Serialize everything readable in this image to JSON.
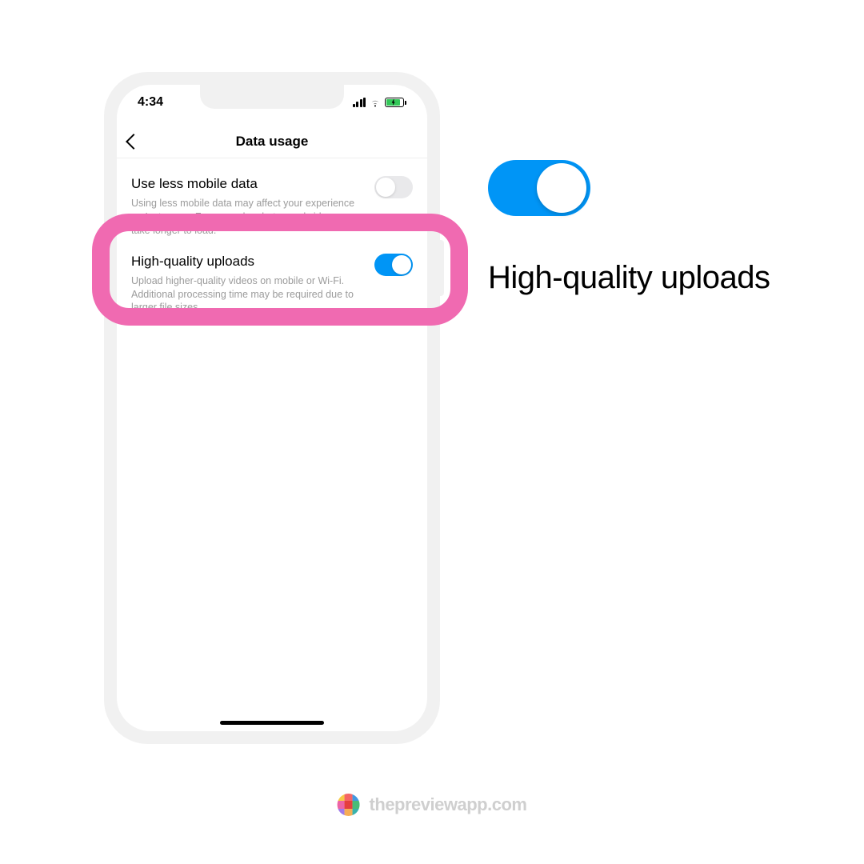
{
  "statusBar": {
    "time": "4:34"
  },
  "nav": {
    "title": "Data usage"
  },
  "rows": {
    "useLessData": {
      "title": "Use less mobile data",
      "desc": "Using less mobile data may affect your experience on Instagram. For example, photos and videos may take longer to load."
    },
    "highQuality": {
      "title": "High-quality uploads",
      "desc": "Upload higher-quality videos on mobile or Wi-Fi. Additional processing time may be required due to larger file sizes."
    }
  },
  "callout": {
    "label": "High-quality uploads"
  },
  "footer": {
    "text": "thepreviewapp.com"
  }
}
